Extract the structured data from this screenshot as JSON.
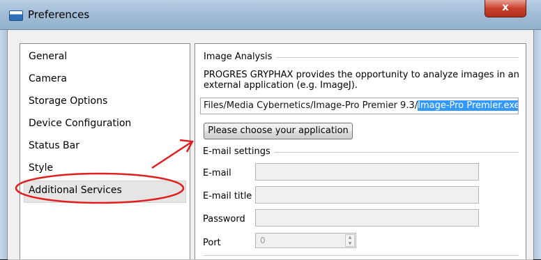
{
  "window": {
    "title": "Preferences",
    "close_glyph": "x",
    "app_icon": "preferences-window-icon"
  },
  "sidebar": {
    "items": [
      {
        "label": "General",
        "selected": false
      },
      {
        "label": "Camera",
        "selected": false
      },
      {
        "label": "Storage Options",
        "selected": false
      },
      {
        "label": "Device Configuration",
        "selected": false
      },
      {
        "label": "Status Bar",
        "selected": false
      },
      {
        "label": "Style",
        "selected": false
      },
      {
        "label": "Additional Services",
        "selected": true
      }
    ]
  },
  "image_analysis": {
    "group_title": "Image Analysis",
    "description": "PROGRES GRYPHAX provides the opportunity to analyze images in an external application (e.g. ImageJ).",
    "path_prefix": "Files/Media Cybernetics/Image-Pro Premier 9.3/",
    "path_selected": "Image-Pro Premier.exe",
    "choose_button_label": "Please choose your application"
  },
  "email_settings": {
    "group_title": "E-mail settings",
    "email_label": "E-mail",
    "email_value": "",
    "title_label": "E-mail title",
    "title_value": "",
    "password_label": "Password",
    "password_value": "",
    "port_label": "Port",
    "port_value": "0"
  },
  "annotation": {
    "color": "#e02020"
  },
  "colors": {
    "selection": "#3399ff",
    "titlebar": "#a3bdd7",
    "close_button": "#c8412c"
  }
}
